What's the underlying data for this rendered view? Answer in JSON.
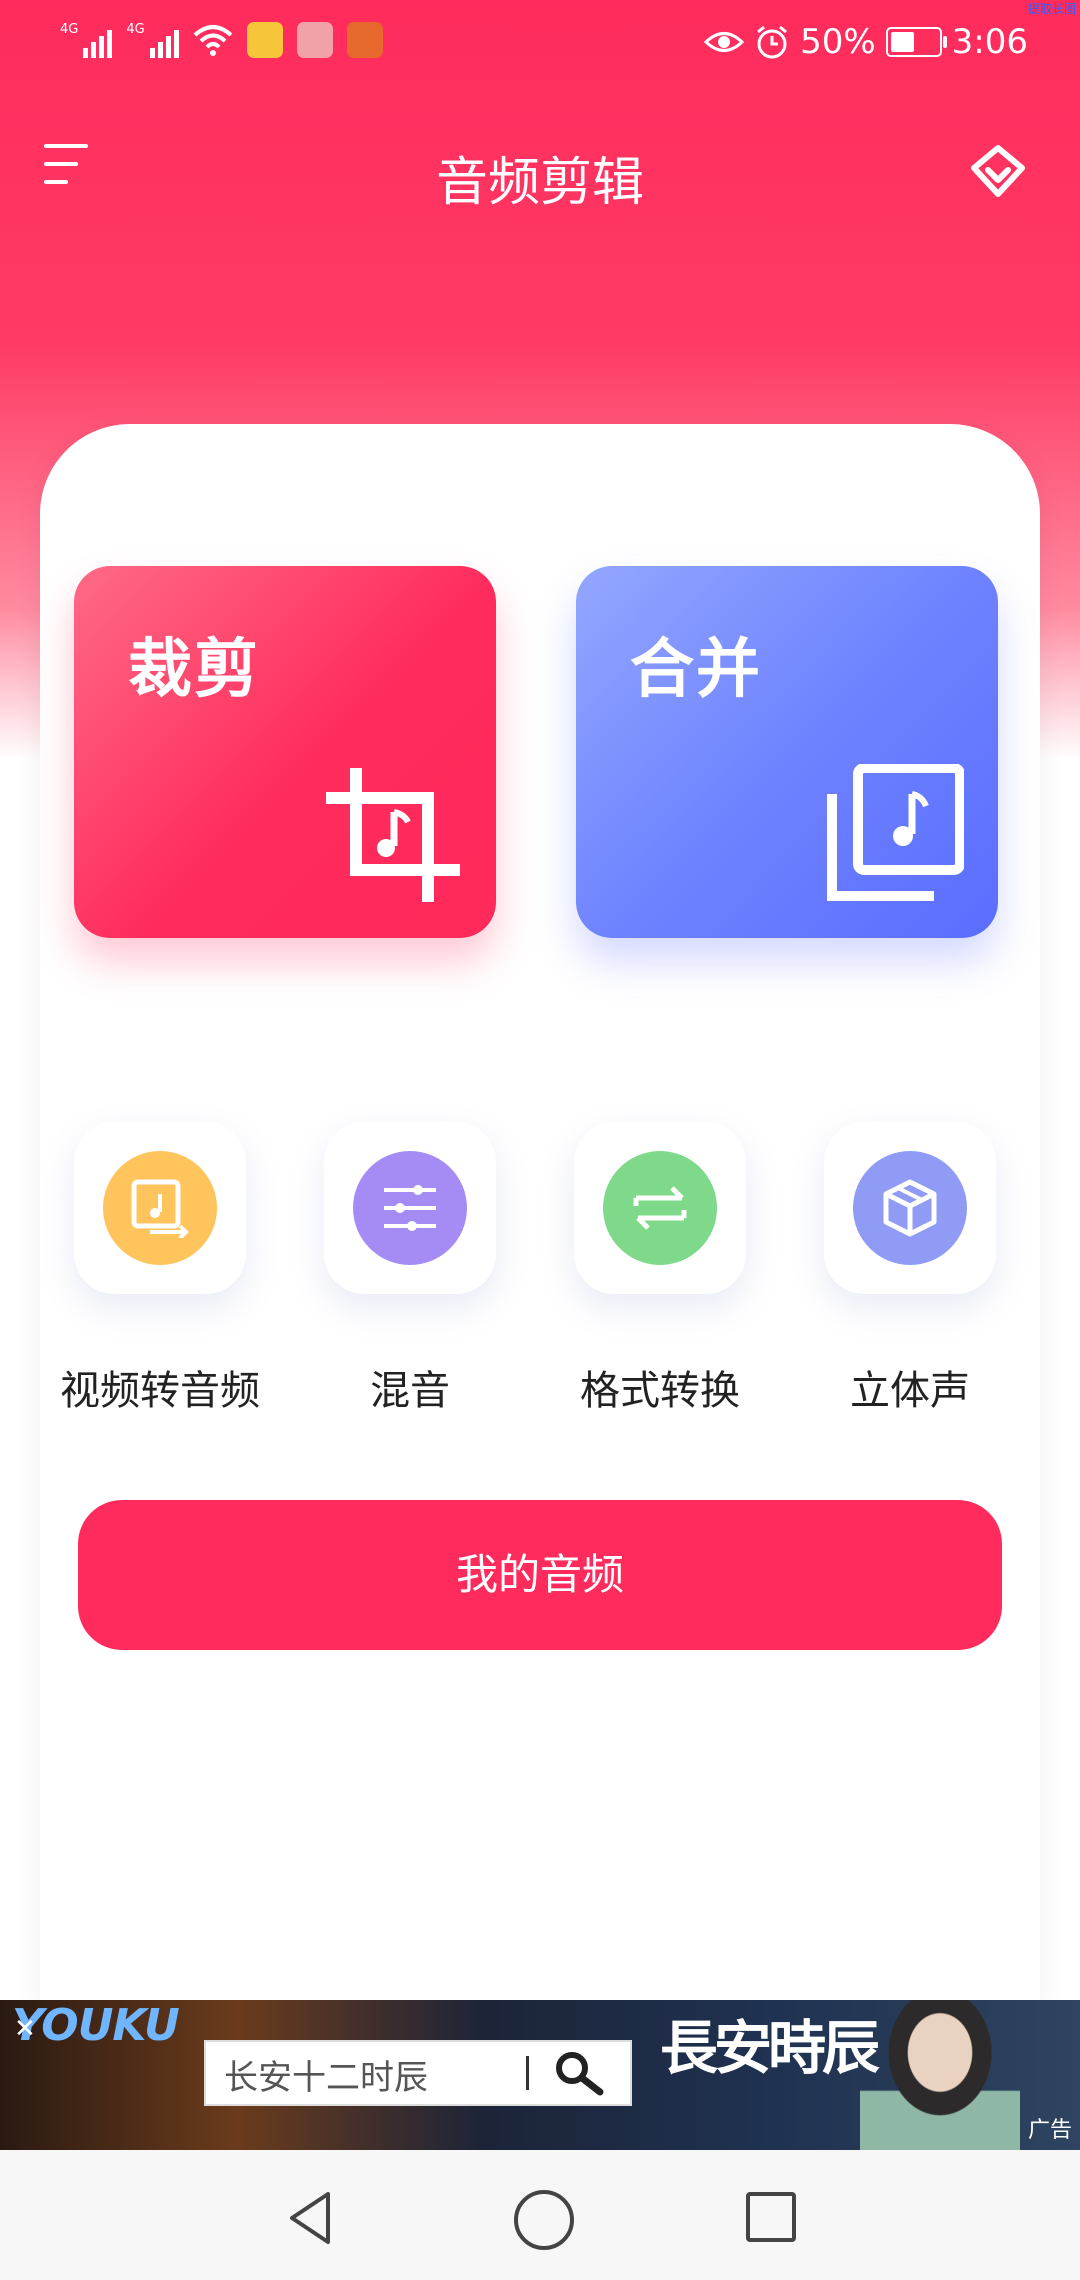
{
  "status_bar": {
    "net1": "4G",
    "net2": "4G",
    "battery_percent_text": "50%",
    "battery_level": 0.5,
    "time": "3:06"
  },
  "app_bar": {
    "title": "音频剪辑"
  },
  "main": {
    "cut_label": "裁剪",
    "merge_label": "合并",
    "tools": [
      {
        "label": "视频转音频",
        "icon": "video-to-audio-icon",
        "color": "#ffc45c"
      },
      {
        "label": "混音",
        "icon": "mixer-sliders-icon",
        "color": "#a58cf5"
      },
      {
        "label": "格式转换",
        "icon": "swap-arrows-icon",
        "color": "#7fd98a"
      },
      {
        "label": "立体声",
        "icon": "cube-icon",
        "color": "#8f9bf4"
      }
    ],
    "my_audio_label": "我的音频"
  },
  "ad": {
    "brand": "YOUKU",
    "search_text": "长安十二时辰",
    "calligraphy": "長安時辰",
    "ad_mark": "广告",
    "top_right_text": "提取长图"
  },
  "colors": {
    "primary": "#ff2b5c",
    "merge_blue": "#5a6dff"
  }
}
